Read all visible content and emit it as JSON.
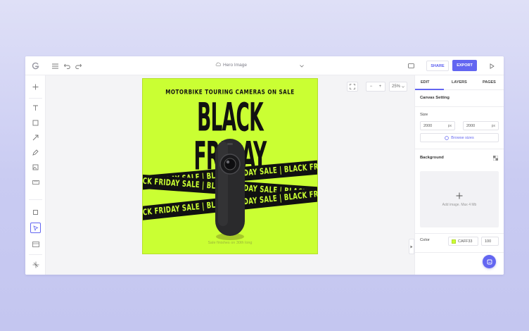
{
  "topbar": {
    "doc_title": "Hero Image",
    "share_label": "SHARE",
    "export_label": "EXPORT"
  },
  "workspace": {
    "zoom_value": "25%",
    "zoom_minus": "−",
    "zoom_plus": "+"
  },
  "design": {
    "subtitle": "MOTORBIKE TOURING CAMERAS ON SALE",
    "headline": "BLACK FRIDAY",
    "band_text": "BLACK FRIDAY SALE | BLACK FRIDAY SALE | BLACK FRIDAY SALE | BLACK FRIDAY SALE |",
    "footnote": "Sale finishes on 30th long",
    "background_color": "#CAFF33"
  },
  "panel": {
    "tabs": [
      "EDIT",
      "LAYERS",
      "PAGES"
    ],
    "section_title": "Canvas Setting",
    "size_label": "Size",
    "width_value": "2000",
    "height_value": "2000",
    "unit": "px",
    "browse_sizes": "Browse sizes",
    "background_label": "Background",
    "add_image_hint": "Add image. Max 4 Mb",
    "color_label": "Color",
    "color_hex": "CAFF33",
    "opacity_value": "100"
  },
  "colors": {
    "accent": "#6366f1",
    "canvas_bg": "#CAFF33"
  }
}
